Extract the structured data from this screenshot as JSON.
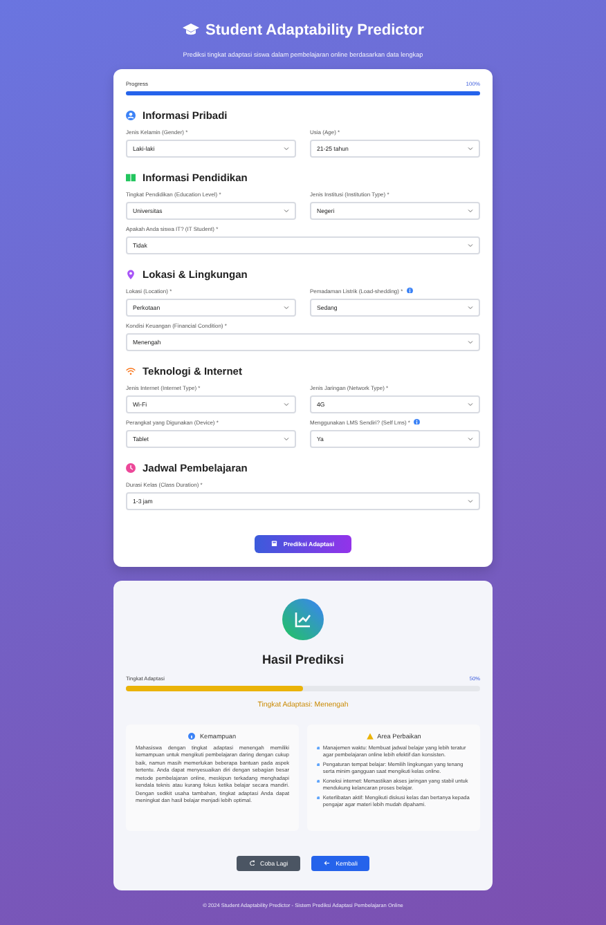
{
  "header": {
    "title": "Student Adaptability Predictor",
    "subtitle": "Prediksi tingkat adaptasi siswa dalam pembelajaran online berdasarkan data lengkap"
  },
  "progress": {
    "label": "Progress",
    "reading": "100%",
    "level": 1
  },
  "sections": [
    {
      "kind": "person",
      "title": "Informasi Pribadi",
      "fields": [
        {
          "label": "Jenis Kelamin (Gender) *",
          "value": "Laki-laki",
          "info": false,
          "wide": false
        },
        {
          "label": "Usia (Age) *",
          "value": "21-25 tahun",
          "info": false,
          "wide": false
        }
      ]
    },
    {
      "kind": "book",
      "title": "Informasi Pendidikan",
      "fields": [
        {
          "label": "Tingkat Pendidikan (Education Level) *",
          "value": "Universitas",
          "info": false,
          "wide": false
        },
        {
          "label": "Jenis Institusi (Institution Type) *",
          "value": "Negeri",
          "info": false,
          "wide": false
        },
        {
          "label": "Apakah Anda siswa IT? (IT Student) *",
          "value": "Tidak",
          "info": false,
          "wide": true
        }
      ]
    },
    {
      "kind": "pin",
      "title": "Lokasi & Lingkungan",
      "fields": [
        {
          "label": "Lokasi (Location) *",
          "value": "Perkotaan",
          "info": false,
          "wide": false
        },
        {
          "label": "Pemadaman Listrik (Load-shedding) *",
          "value": "Sedang",
          "info": true,
          "wide": false
        },
        {
          "label": "Kondisi Keuangan (Financial Condition) *",
          "value": "Menengah",
          "info": false,
          "wide": true
        }
      ]
    },
    {
      "kind": "wifi",
      "title": "Teknologi & Internet",
      "fields": [
        {
          "label": "Jenis Internet (Internet Type) *",
          "value": "Wi-Fi",
          "info": false,
          "wide": false
        },
        {
          "label": "Jenis Jaringan (Network Type) *",
          "value": "4G",
          "info": false,
          "wide": false
        },
        {
          "label": "Perangkat yang Digunakan (Device) *",
          "value": "Tablet",
          "info": false,
          "wide": false
        },
        {
          "label": "Menggunakan LMS Sendiri? (Self Lms) *",
          "value": "Ya",
          "info": true,
          "wide": false
        }
      ]
    },
    {
      "kind": "clock",
      "title": "Jadwal Pembelajaran",
      "fields": [
        {
          "label": "Durasi Kelas (Class Duration) *",
          "value": "1-3 jam",
          "info": false,
          "wide": true
        }
      ]
    }
  ],
  "submit_button": "Prediksi Adaptasi",
  "result": {
    "title": "Hasil Prediksi",
    "meter_label": "Tingkat Adaptasi",
    "reading": "50%",
    "level": 0.5,
    "verdict": "Tingkat Adaptasi: Menengah",
    "strengths": {
      "title": "Kemampuan",
      "text": "Mahasiswa dengan tingkat adaptasi menengah memiliki kemampuan untuk mengikuti pembelajaran daring dengan cukup baik, namun masih memerlukan beberapa bantuan pada aspek tertentu. Anda dapat menyesuaikan diri dengan sebagian besar metode pembelajaran online, meskipun terkadang menghadapi kendala teknis atau kurang fokus ketika belajar secara mandiri. Dengan sedikit usaha tambahan, tingkat adaptasi Anda dapat meningkat dan hasil belajar menjadi lebih optimal."
    },
    "improvements": {
      "title": "Area Perbaikan",
      "items": [
        "Manajemen waktu: Membuat jadwal belajar yang lebih teratur agar pembelajaran online lebih efektif dan konsisten.",
        "Pengaturan tempat belajar: Memilih lingkungan yang tenang serta minim gangguan saat mengikuti kelas online.",
        "Koneksi internet: Memastikan akses jaringan yang stabil untuk mendukung kelancaran proses belajar.",
        "Keterlibatan aktif: Mengikuti diskusi kelas dan bertanya kepada pengajar agar materi lebih mudah dipahami."
      ]
    },
    "buttons": [
      {
        "kind": "retry",
        "label": "Coba Lagi"
      },
      {
        "kind": "back",
        "label": "Kembali"
      }
    ]
  },
  "footer": "© 2024 Student Adaptability Predictor - Sistem Prediksi Adaptasi Pembelajaran Online"
}
